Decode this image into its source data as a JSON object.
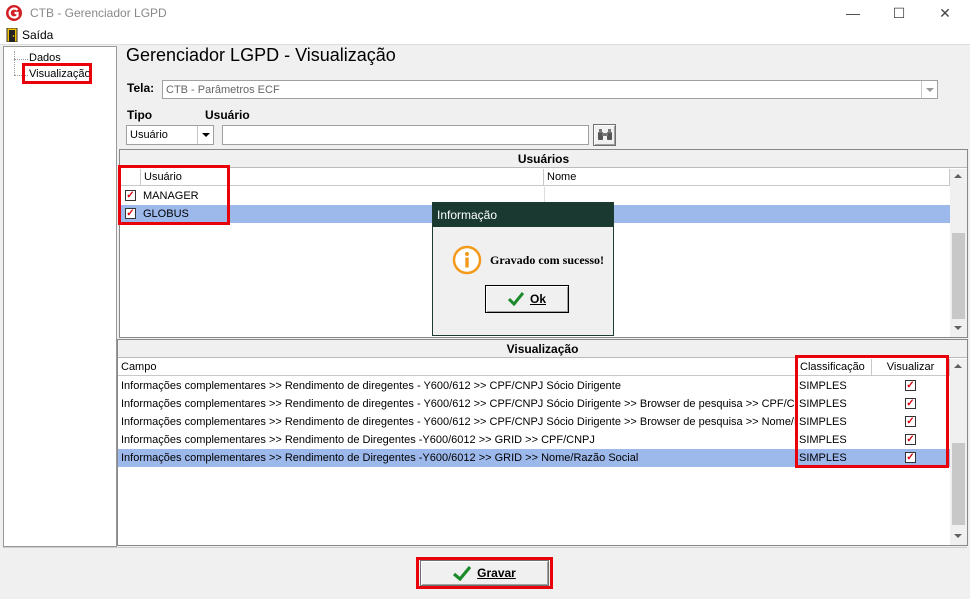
{
  "window": {
    "title": "CTB - Gerenciador LGPD",
    "minimize": "—",
    "maximize": "☐",
    "close": "✕"
  },
  "menu": {
    "saida": "Saída"
  },
  "tree": {
    "items": [
      "Dados",
      "Visualização"
    ]
  },
  "page_title": "Gerenciador LGPD - Visualização",
  "tela": {
    "label": "Tela:",
    "value": "CTB - Parâmetros ECF"
  },
  "tipo": {
    "label": "Tipo",
    "value": "Usuário"
  },
  "usuario_filter": {
    "label": "Usuário",
    "value": ""
  },
  "usuarios_panel": {
    "title": "Usuários",
    "columns": [
      "Usuário",
      "Nome"
    ],
    "rows": [
      {
        "checked": true,
        "usuario": "MANAGER",
        "nome": ""
      },
      {
        "checked": true,
        "usuario": "GLOBUS",
        "nome": ""
      }
    ]
  },
  "visualizacao_panel": {
    "title": "Visualização",
    "columns": [
      "Campo",
      "Classificação",
      "Visualizar"
    ],
    "rows": [
      {
        "campo": "Informações complementares >> Rendimento de diregentes - Y600/612 >> CPF/CNPJ Sócio Dirigente",
        "classificacao": "SIMPLES",
        "visualizar": true
      },
      {
        "campo": "Informações complementares >> Rendimento de diregentes - Y600/612 >> CPF/CNPJ Sócio Dirigente >> Browser de pesquisa >> CPF/CNPJ",
        "classificacao": "SIMPLES",
        "visualizar": true
      },
      {
        "campo": "Informações complementares >> Rendimento de diregentes - Y600/612 >> CPF/CNPJ Sócio Dirigente >> Browser de pesquisa >> Nome/Ra...",
        "classificacao": "SIMPLES",
        "visualizar": true
      },
      {
        "campo": "Informações complementares >> Rendimento de Diregentes -Y600/6012 >> GRID >> CPF/CNPJ",
        "classificacao": "SIMPLES",
        "visualizar": true
      },
      {
        "campo": "Informações complementares >> Rendimento de Diregentes -Y600/6012 >> GRID >> Nome/Razão Social",
        "classificacao": "SIMPLES",
        "visualizar": true
      }
    ]
  },
  "dialog": {
    "title": "Informação",
    "message": "Gravado com sucesso!",
    "ok_label": "Ok"
  },
  "gravar_label": "Gravar",
  "colors": {
    "highlight": "#e8000b",
    "selection": "#9db9eb",
    "dialog_header": "#1a3a31",
    "check_green": "#1c8a2a",
    "info_orange": "#f39a1b"
  },
  "icons": [
    "app-logo-icon",
    "exit-door-icon",
    "binoculars-icon",
    "info-icon",
    "checkmark-icon"
  ]
}
